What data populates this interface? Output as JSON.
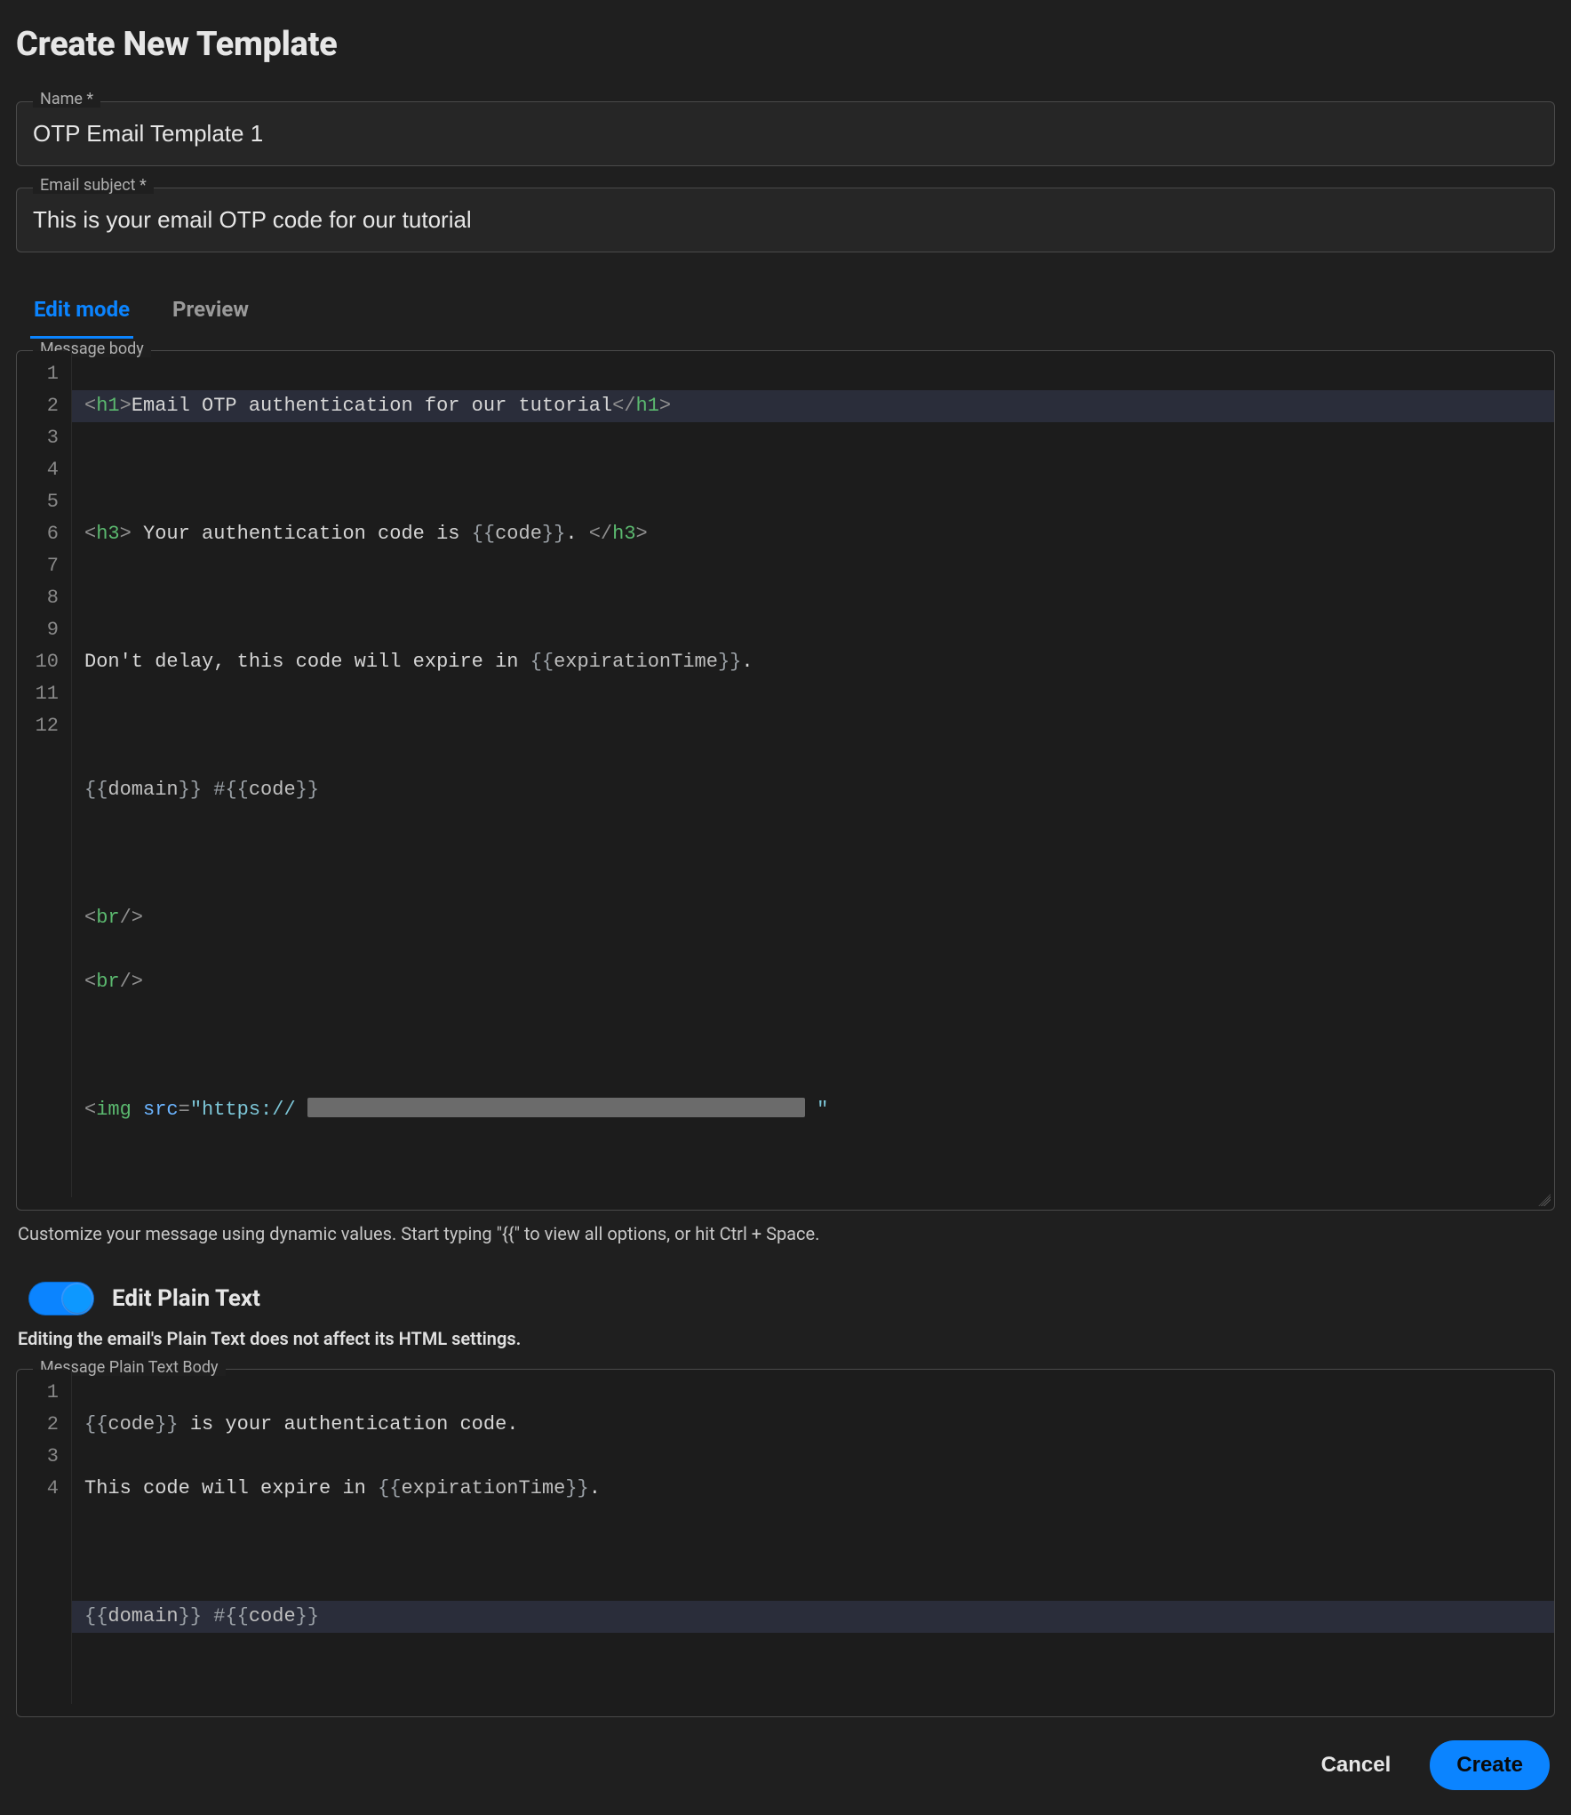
{
  "page_title": "Create New Template",
  "fields": {
    "name": {
      "label": "Name *",
      "value": "OTP Email Template 1"
    },
    "subject": {
      "label": "Email subject *",
      "value": "This is your email OTP code for our tutorial"
    }
  },
  "tabs": {
    "edit": {
      "label": "Edit mode",
      "active": true
    },
    "preview": {
      "label": "Preview",
      "active": false
    }
  },
  "html_editor": {
    "label": "Message body",
    "lines": [
      "1",
      "2",
      "3",
      "4",
      "5",
      "6",
      "7",
      "8",
      "9",
      "10",
      "11",
      "12"
    ],
    "l1_text": "Email OTP authentication for our tutorial",
    "l3_text": " Your authentication code is ",
    "l3_var": "code",
    "l3_text2": ". ",
    "l5_text": "Don't delay, this code will expire in ",
    "l5_var": "expirationTime",
    "l5_text2": ".",
    "l7_var1": "domain",
    "l7_hash": " #",
    "l7_var2": "code",
    "l12_url_prefix": "https://"
  },
  "helper_text": "Customize your message using dynamic values. Start typing \"{{\" to view all options, or hit Ctrl + Space.",
  "plain_toggle": {
    "label": "Edit Plain Text",
    "on": true,
    "note": "Editing the email's Plain Text does not affect its HTML settings."
  },
  "plain_editor": {
    "label": "Message Plain Text Body",
    "lines": [
      "1",
      "2",
      "3",
      "4"
    ],
    "l1_var": "code",
    "l1_text": " is your authentication code.",
    "l2_text": "This code will expire in ",
    "l2_var": "expirationTime",
    "l2_text2": ".",
    "l4_var1": "domain",
    "l4_hash": " #",
    "l4_var2": "code"
  },
  "actions": {
    "cancel": "Cancel",
    "create": "Create"
  }
}
